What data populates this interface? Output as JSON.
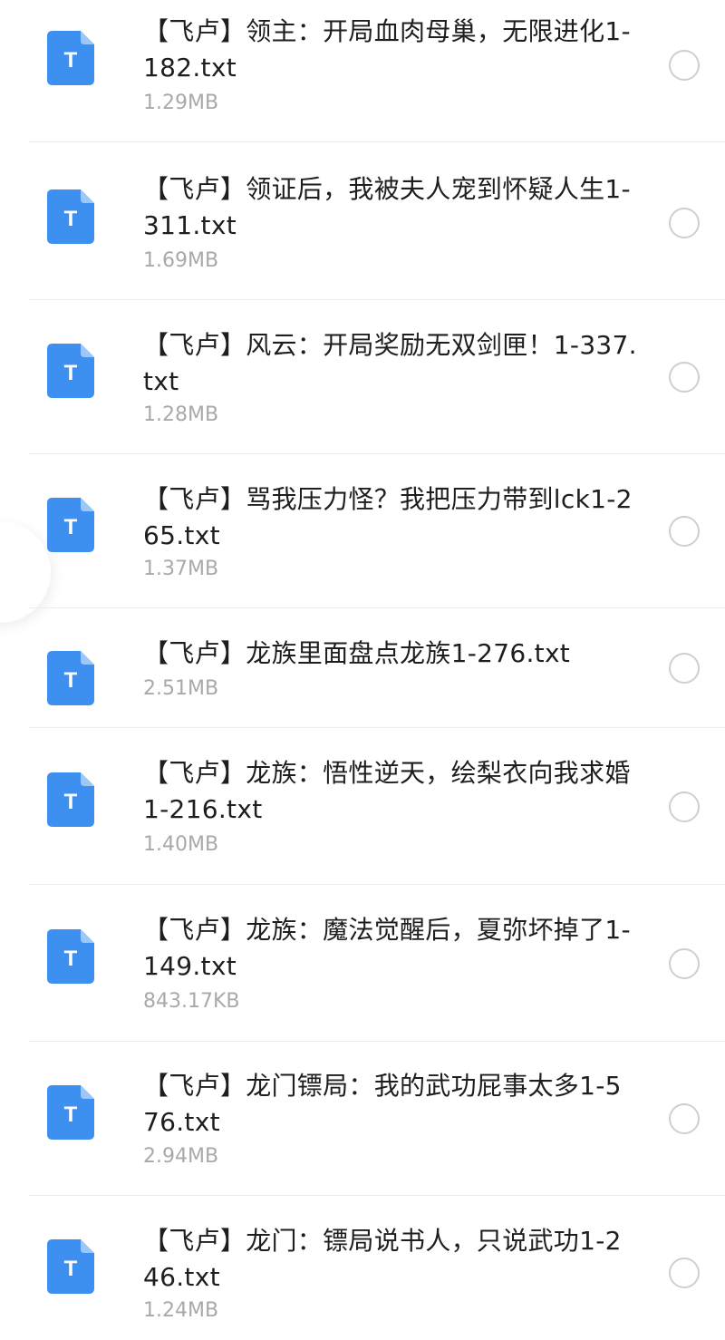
{
  "icon_color": "#3d8ff0",
  "file_icon": "txt-file-icon",
  "icon_letter": "T",
  "files": [
    {
      "name": "【飞卢】领主：开局血肉母巢，无限进化1-182.txt",
      "size": "1.29MB"
    },
    {
      "name": "【飞卢】领证后，我被夫人宠到怀疑人生1-311.txt",
      "size": "1.69MB"
    },
    {
      "name": "【飞卢】风云：开局奖励无双剑匣！1-337.txt",
      "size": "1.28MB"
    },
    {
      "name": "【飞卢】骂我压力怪？我把压力带到lck1-265.txt",
      "size": "1.37MB"
    },
    {
      "name": "【飞卢】龙族里面盘点龙族1-276.txt",
      "size": "2.51MB"
    },
    {
      "name": "【飞卢】龙族：悟性逆天，绘梨衣向我求婚1-216.txt",
      "size": "1.40MB"
    },
    {
      "name": "【飞卢】龙族：魔法觉醒后，夏弥坏掉了1-149.txt",
      "size": "843.17KB"
    },
    {
      "name": "【飞卢】龙门镖局：我的武功屁事太多1-576.txt",
      "size": "2.94MB"
    },
    {
      "name": "【飞卢】龙门：镖局说书人，只说武功1-246.txt",
      "size": "1.24MB"
    }
  ]
}
